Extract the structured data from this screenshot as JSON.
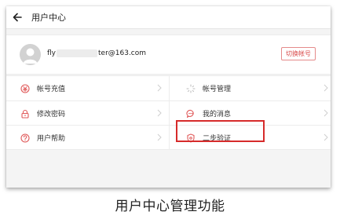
{
  "header": {
    "title": "用户中心"
  },
  "profile": {
    "username_prefix": "fly",
    "username_suffix": "ter@163.com",
    "switch_account_label": "切换帐号"
  },
  "menu": {
    "rows": [
      {
        "left": {
          "label": "帐号充值",
          "icon": "recharge-icon"
        },
        "right": {
          "label": "帐号管理",
          "icon": "loading-spinner-icon"
        }
      },
      {
        "left": {
          "label": "修改密码",
          "icon": "lock-icon"
        },
        "right": {
          "label": "我的消息",
          "icon": "message-icon"
        }
      },
      {
        "left": {
          "label": "用户帮助",
          "icon": "help-icon"
        },
        "right": {
          "label": "二步验证",
          "icon": "shield-icon"
        }
      }
    ]
  },
  "caption": "用户中心管理功能",
  "colors": {
    "accent": "#e05a5a",
    "highlight_border": "#d62b2b",
    "background": "#f4f4f4"
  }
}
